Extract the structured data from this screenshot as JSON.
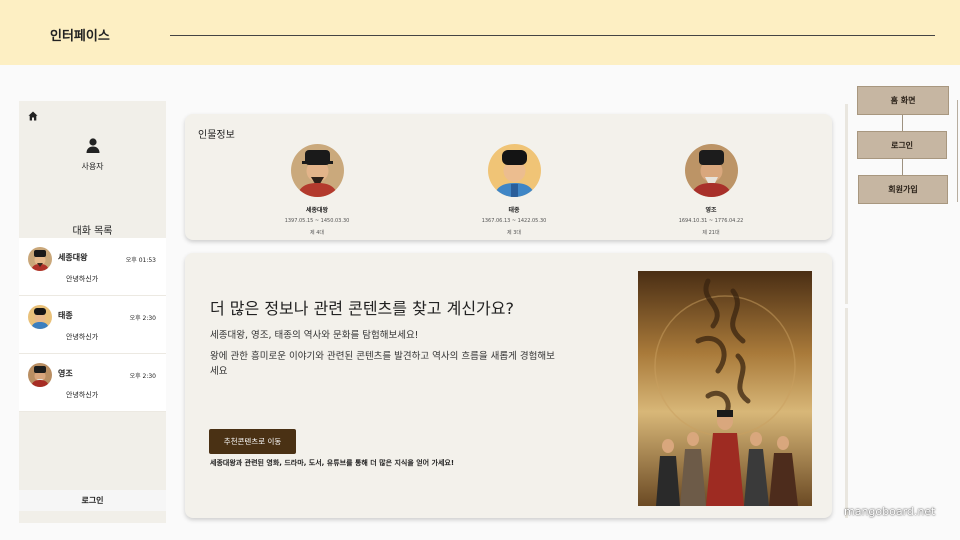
{
  "header": {
    "title": "인터페이스"
  },
  "sidebar": {
    "user_label": "사용자",
    "chat_title": "대화 목록",
    "chats": [
      {
        "name": "세종대왕",
        "time": "오후 01:53",
        "message": "안녕하신가"
      },
      {
        "name": "태종",
        "time": "오후 2:30",
        "message": "안녕하신가"
      },
      {
        "name": "영조",
        "time": "오후 2:30",
        "message": "안녕하신가"
      }
    ],
    "login_label": "로그인"
  },
  "people": {
    "title": "인물정보",
    "items": [
      {
        "name": "세종대왕",
        "dates": "1397.05.15 ~ 1450.03.30",
        "order": "제 4대"
      },
      {
        "name": "태종",
        "dates": "1367.06.13 ~ 1422.05.30",
        "order": "제 3대"
      },
      {
        "name": "영조",
        "dates": "1694.10.31 ~ 1776.04.22",
        "order": "제 21대"
      }
    ]
  },
  "promo": {
    "heading": "더 많은 정보나 관련 콘텐츠를 찾고 계신가요?",
    "line1": "세종대왕, 영조, 태종의 역사와 문화를 탐험해보세요!",
    "line2": "왕에 관한 흥미로운 이야기와 관련된 콘텐츠를 발견하고 역사의 흐름을 새롭게 경험해보세요",
    "button_label": "추천콘텐츠로 이동",
    "caption": "세종대왕과 관련된 영화, 드라마, 도서, 유튜브를 통해 더 많은 지식을 얻어 가세요!"
  },
  "nav": {
    "home": "홈 화면",
    "login": "로그인",
    "signup": "회원가입"
  },
  "watermark": "mangoboard.net",
  "colors": {
    "header_bg": "#fdefc3",
    "nav_button": "#c6b6a2",
    "promo_button": "#4a3114",
    "card_bg": "#f3f1eb"
  },
  "icons": {
    "home": "home-icon",
    "user": "user-icon"
  }
}
